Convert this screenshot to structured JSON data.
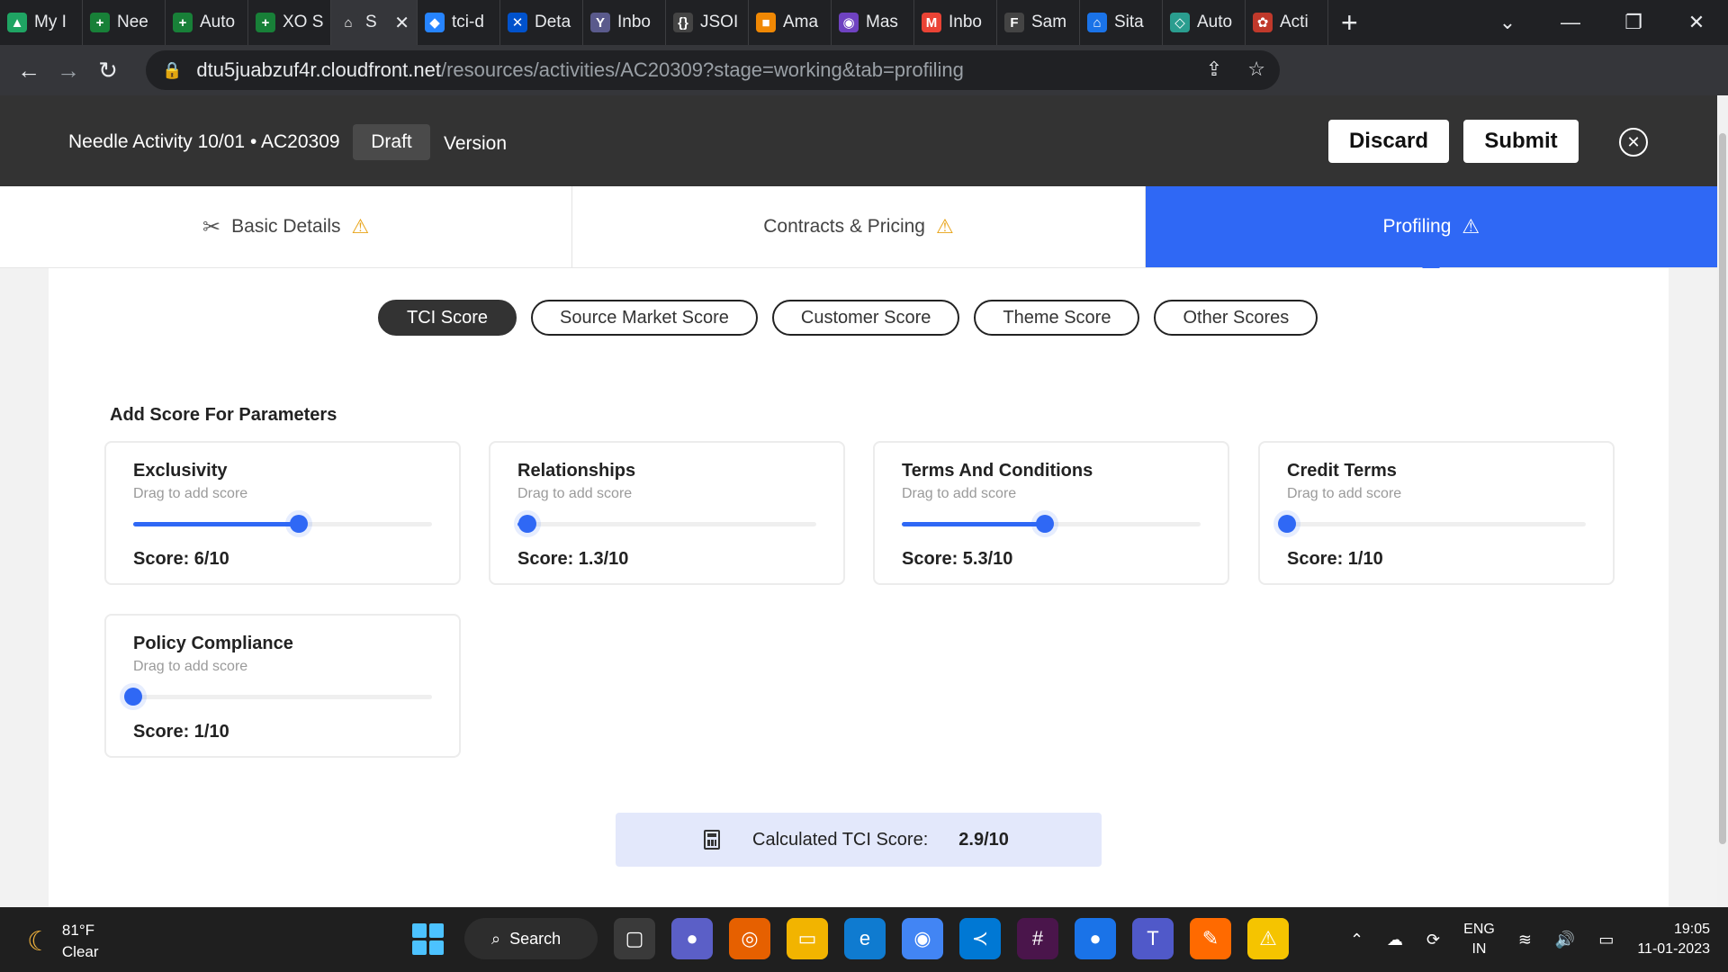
{
  "browser": {
    "tabs": [
      {
        "title": "My I",
        "color": "#1fa463",
        "glyph": "▲"
      },
      {
        "title": "Nee",
        "color": "#188038",
        "glyph": "+"
      },
      {
        "title": "Auto",
        "color": "#188038",
        "glyph": "+"
      },
      {
        "title": "XO S",
        "color": "#188038",
        "glyph": "+"
      },
      {
        "title": "S",
        "color": "#35363a",
        "glyph": "⌂",
        "active": true
      },
      {
        "title": "tci-d",
        "color": "#2684ff",
        "glyph": "◆"
      },
      {
        "title": "Deta",
        "color": "#0052cc",
        "glyph": "✕"
      },
      {
        "title": "Inbo",
        "color": "#5a5a8c",
        "glyph": "Y"
      },
      {
        "title": "JSOI",
        "color": "#444",
        "glyph": "{}"
      },
      {
        "title": "Ama",
        "color": "#f08804",
        "glyph": "■"
      },
      {
        "title": "Mas",
        "color": "#6f42c1",
        "glyph": "◉"
      },
      {
        "title": "Inbo",
        "color": "#ea4335",
        "glyph": "M"
      },
      {
        "title": "Sam",
        "color": "#444",
        "glyph": "F"
      },
      {
        "title": "Sita",
        "color": "#1a73e8",
        "glyph": "⌂"
      },
      {
        "title": "Auto",
        "color": "#2a9d8f",
        "glyph": "◇"
      },
      {
        "title": "Acti",
        "color": "#c0392b",
        "glyph": "✿"
      }
    ],
    "close_tab_glyph": "✕",
    "new_tab_glyph": "+",
    "window_controls": [
      "⌄",
      "—",
      "❐",
      "✕"
    ],
    "url_host": "dtu5juabzuf4r.cloudfront.net",
    "url_path": "/resources/activities/AC20309?stage=working&tab=profiling",
    "nav": {
      "back": "←",
      "forward": "→",
      "reload": "↻"
    },
    "lock_glyph": "🔒",
    "share_glyph": "⇪",
    "star_glyph": "☆",
    "extensions": [
      "#ffffff",
      "#ff6f61",
      "#e53935",
      "#f5a623",
      "#f9d71c",
      "#34c759",
      "#dadce0",
      "#dadce0",
      "#a37b6d"
    ]
  },
  "header": {
    "title": "Needle Activity 10/01 • AC20309",
    "status": "Draft",
    "version": "Version",
    "discard": "Discard",
    "submit": "Submit",
    "close_glyph": "✕"
  },
  "main_tabs": {
    "basic": "Basic Details",
    "contracts": "Contracts & Pricing",
    "profiling": "Profiling",
    "warn_glyph": "⚠",
    "tool_glyph": "✂"
  },
  "score_tabs": {
    "tci": "TCI Score",
    "source": "Source Market Score",
    "customer": "Customer Score",
    "theme": "Theme Score",
    "other": "Other Scores"
  },
  "section_title": "Add Score For Parameters",
  "hint": "Drag to add score",
  "parameters": [
    {
      "name": "Exclusivity",
      "score_label": "Score: 6/10",
      "value": 6
    },
    {
      "name": "Relationships",
      "score_label": "Score: 1.3/10",
      "value": 1.3
    },
    {
      "name": "Terms And Conditions",
      "score_label": "Score: 5.3/10",
      "value": 5.3
    },
    {
      "name": "Credit Terms",
      "score_label": "Score: 1/10",
      "value": 1
    },
    {
      "name": "Policy Compliance",
      "score_label": "Score: 1/10",
      "value": 1
    }
  ],
  "slider_range": [
    1,
    10
  ],
  "calculated": {
    "label": "Calculated TCI Score:",
    "value": "2.9/10"
  },
  "taskbar": {
    "temp": "81°F",
    "condition": "Clear",
    "search": "Search",
    "search_glyph": "⌕",
    "apps": [
      {
        "glyph": "▢",
        "color": "#3a3a3a"
      },
      {
        "glyph": "●",
        "color": "#5b5fc7"
      },
      {
        "glyph": "◎",
        "color": "#e66000"
      },
      {
        "glyph": "▭",
        "color": "#f2b400"
      },
      {
        "glyph": "e",
        "color": "#0f7bd0"
      },
      {
        "glyph": "◉",
        "color": "#4285f4"
      },
      {
        "glyph": "≺",
        "color": "#0078d4"
      },
      {
        "glyph": "#",
        "color": "#4a154b"
      },
      {
        "glyph": "●",
        "color": "#1a73e8"
      },
      {
        "glyph": "T",
        "color": "#5059c9"
      },
      {
        "glyph": "✎",
        "color": "#ff6a00"
      },
      {
        "glyph": "⚠",
        "color": "#f5c400"
      }
    ],
    "lang_1": "ENG",
    "lang_2": "IN",
    "time": "19:05",
    "date": "11-01-2023"
  }
}
